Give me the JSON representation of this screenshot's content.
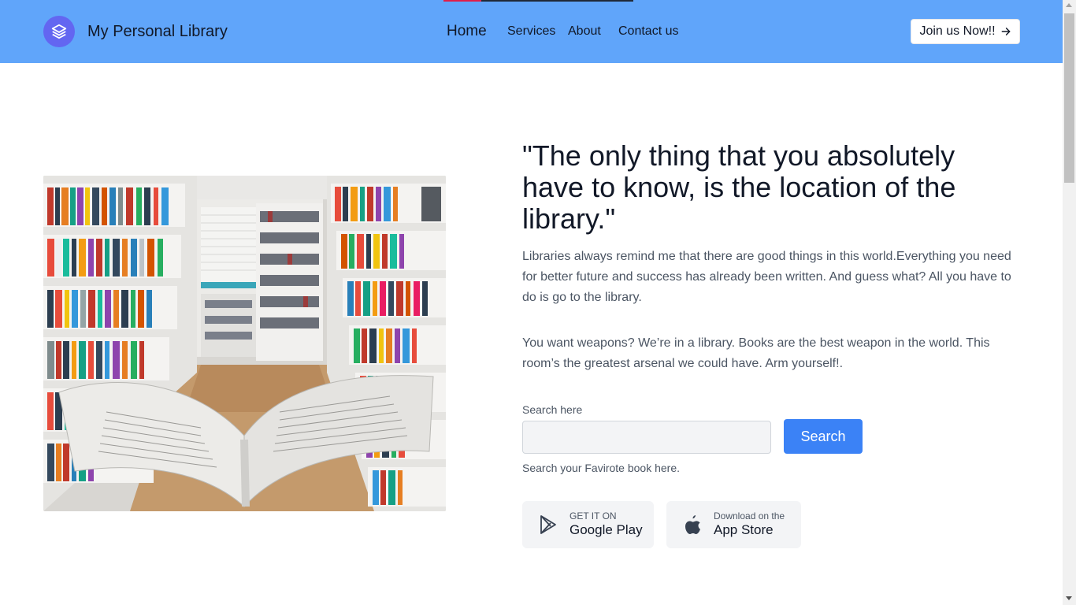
{
  "header": {
    "brand": "My Personal Library",
    "nav": {
      "home": "Home",
      "services": "Services",
      "about": "About",
      "contact": "Contact us"
    },
    "join_label": "Join us Now!!",
    "bg_color": "#60a5fa",
    "logo_color": "#6366f1"
  },
  "hero": {
    "image": "library-bookshelves-open-book-photo",
    "headline": "\"The only thing that you absolutely have to know, is the location of the library.\"",
    "paragraph1": "Libraries always remind me that there are good things in this world.Everything you need for better future and success has already been written. And guess what? All you have to do is go to the library.",
    "paragraph2": "You want weapons? We’re in a library. Books are the best weapon in the world. This room’s the greatest arsenal we could have. Arm yourself!."
  },
  "search": {
    "label": "Search here",
    "value": "",
    "button_label": "Search",
    "help_text": "Search your Favirote book here.",
    "button_color": "#3b82f6"
  },
  "stores": {
    "google_play": {
      "small": "GET IT ON",
      "big": "Google Play",
      "icon": "google-play-icon"
    },
    "app_store": {
      "small": "Download on the",
      "big": "App Store",
      "icon": "apple-icon"
    }
  }
}
